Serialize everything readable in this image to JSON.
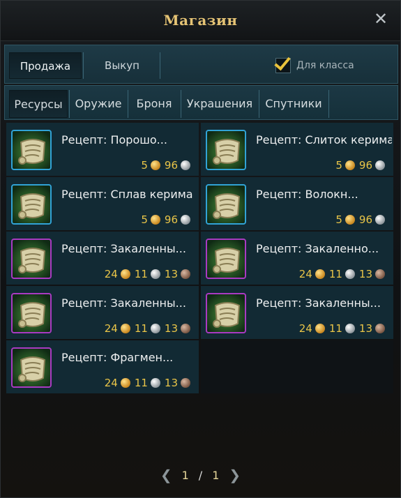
{
  "window": {
    "title": "Магазин"
  },
  "top_tabs": [
    {
      "label": "Продажа",
      "active": true
    },
    {
      "label": "Выкуп",
      "active": false
    }
  ],
  "class_filter": {
    "label": "Для класса",
    "checked": true
  },
  "sub_tabs": [
    {
      "label": "Ресурсы",
      "active": true
    },
    {
      "label": "Оружие",
      "active": false
    },
    {
      "label": "Броня",
      "active": false
    },
    {
      "label": "Украшения",
      "active": false
    },
    {
      "label": "Спутники",
      "active": false
    }
  ],
  "items": [
    {
      "name": "Рецепт: Порошо...",
      "rarity": "blue",
      "gold": "5",
      "silver": "96",
      "bronze": ""
    },
    {
      "name": "Рецепт: Слиток керима",
      "rarity": "blue",
      "gold": "5",
      "silver": "96",
      "bronze": ""
    },
    {
      "name": "Рецепт: Сплав керима",
      "rarity": "blue",
      "gold": "5",
      "silver": "96",
      "bronze": ""
    },
    {
      "name": "Рецепт: Волокн...",
      "rarity": "blue",
      "gold": "5",
      "silver": "96",
      "bronze": ""
    },
    {
      "name": "Рецепт: Закаленны...",
      "rarity": "purple",
      "gold": "24",
      "silver": "11",
      "bronze": "13"
    },
    {
      "name": "Рецепт: Закаленно...",
      "rarity": "purple",
      "gold": "24",
      "silver": "11",
      "bronze": "13"
    },
    {
      "name": "Рецепт: Закаленны...",
      "rarity": "purple",
      "gold": "24",
      "silver": "11",
      "bronze": "13"
    },
    {
      "name": "Рецепт: Закаленны...",
      "rarity": "purple",
      "gold": "24",
      "silver": "11",
      "bronze": "13"
    },
    {
      "name": "Рецепт: Фрагмен...",
      "rarity": "purple",
      "gold": "24",
      "silver": "11",
      "bronze": "13"
    }
  ],
  "pager": {
    "current": "1",
    "separator": "/",
    "total": "1"
  },
  "colors": {
    "title": "#e6c475",
    "price": "#e9c548",
    "rarity_blue": "#31a3d6",
    "rarity_purple": "#a93ac2",
    "panel": "#122a34"
  },
  "icons": {
    "close": "close-icon",
    "item": "recipe-scroll-icon",
    "prev": "chevron-left-icon",
    "next": "chevron-right-icon"
  }
}
